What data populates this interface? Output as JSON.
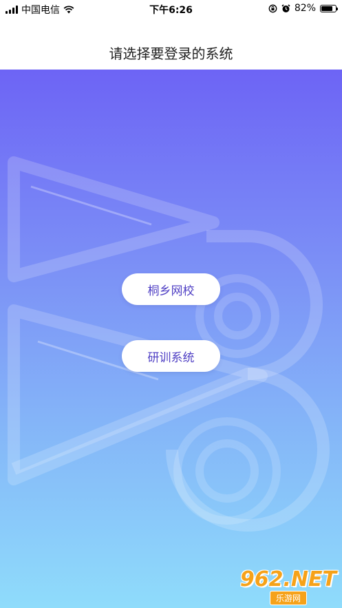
{
  "status_bar": {
    "carrier": "中国电信",
    "time": "下午6:26",
    "battery_percent": "82%",
    "battery_level": 0.82
  },
  "nav": {
    "title": "请选择要登录的系统"
  },
  "buttons": [
    {
      "label": "桐乡网校"
    },
    {
      "label": "研训系统"
    }
  ],
  "watermark": {
    "top": "962.NET",
    "bottom": "乐游网"
  },
  "colors": {
    "gradient_top": "#6d64f5",
    "gradient_bottom": "#8fdcfb",
    "button_text": "#4f3fc4",
    "watermark_orange": "#f6a21a"
  },
  "icons": [
    "signal-icon",
    "wifi-icon",
    "orientation-lock-icon",
    "alarm-icon",
    "battery-icon"
  ]
}
